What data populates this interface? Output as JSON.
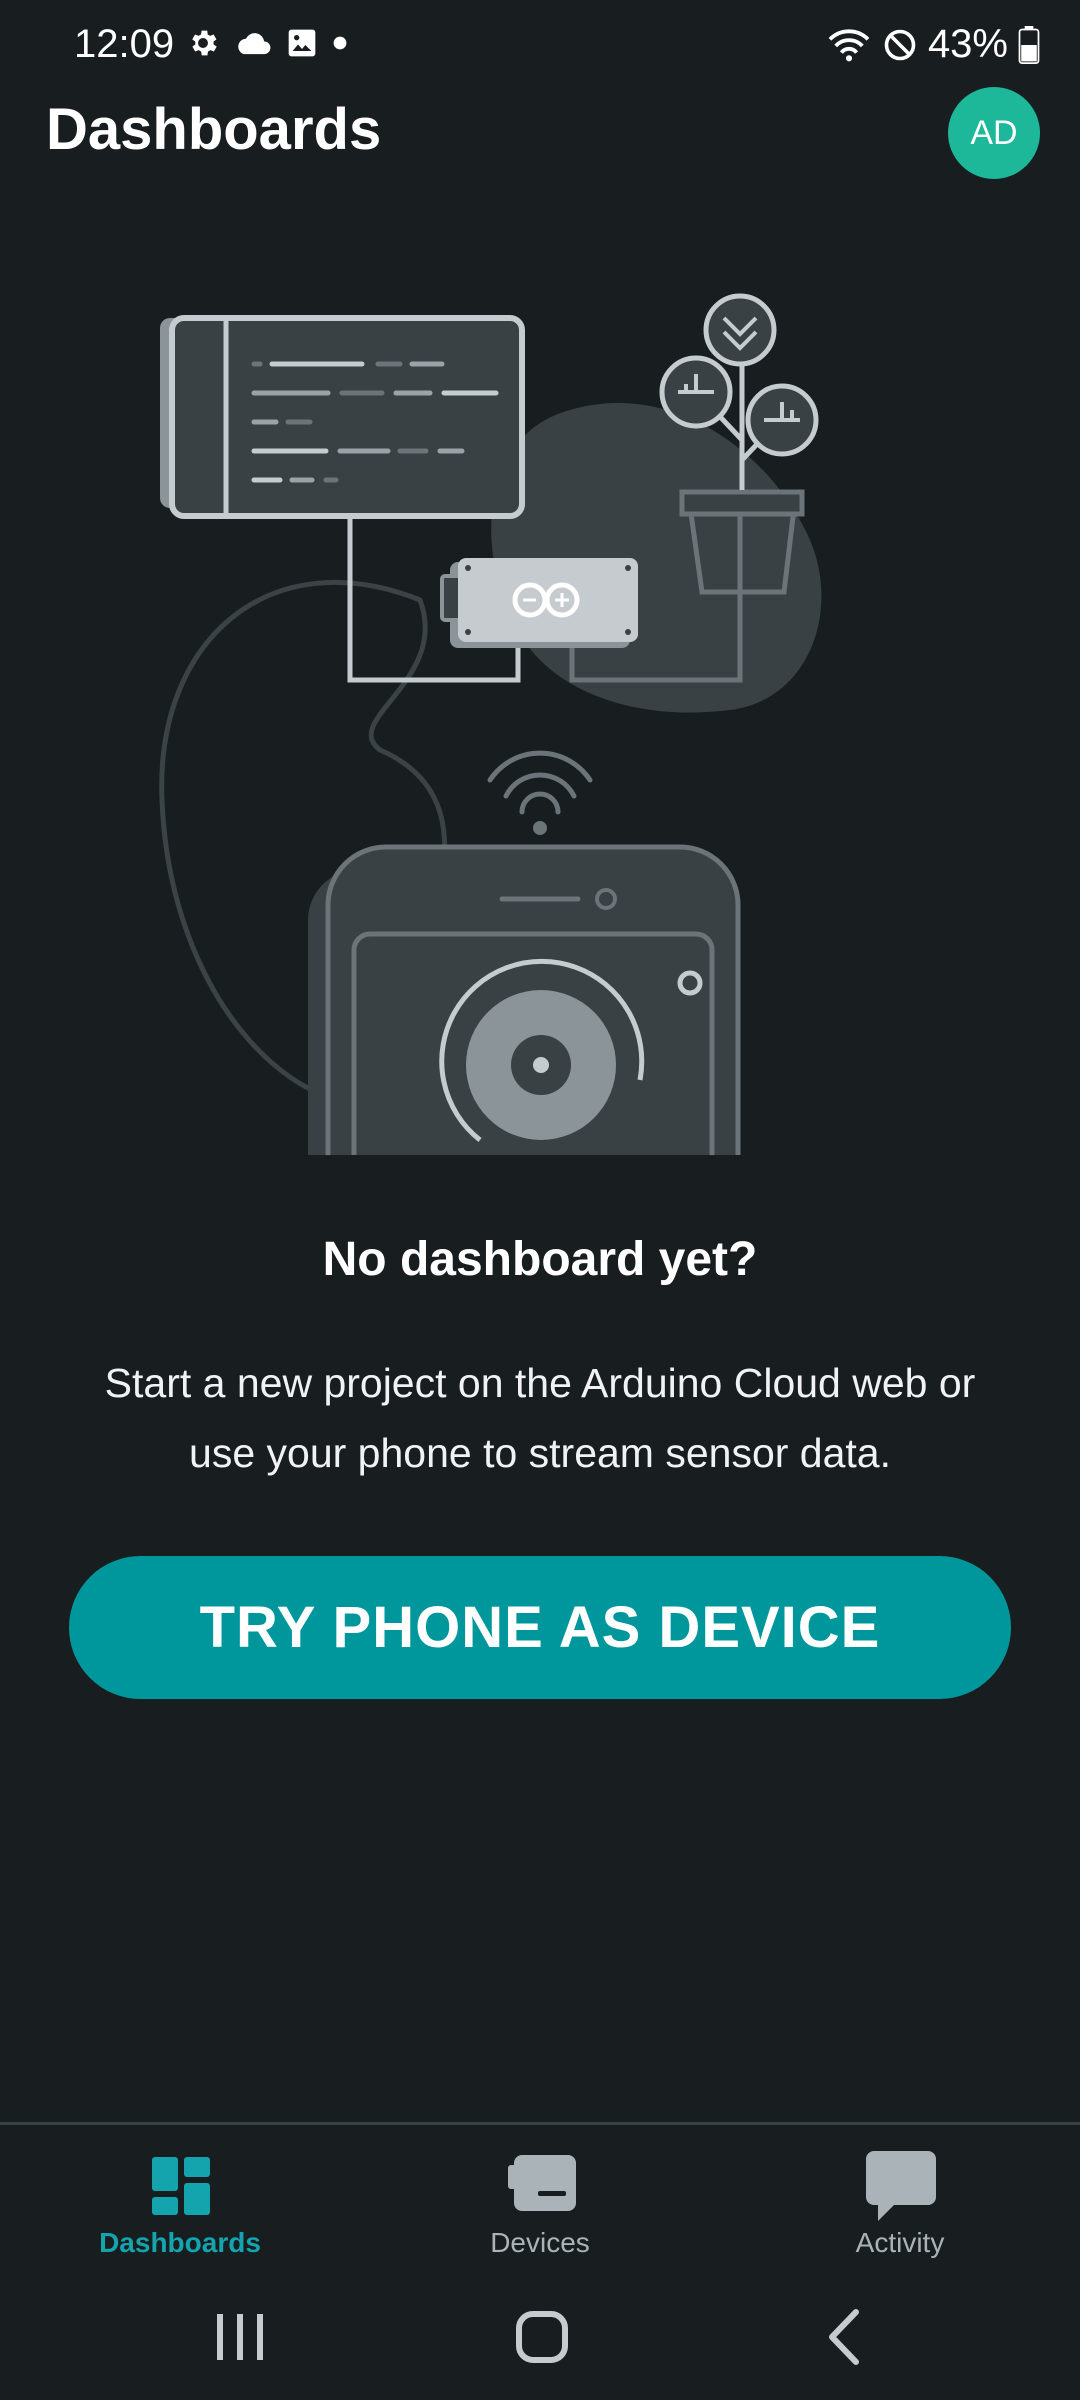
{
  "status_bar": {
    "time": "12:09",
    "battery": "43%"
  },
  "header": {
    "title": "Dashboards",
    "avatar_initials": "AD"
  },
  "empty_state": {
    "title": "No dashboard yet?",
    "description": "Start a new project on the Arduino Cloud web or use your phone to stream sensor data."
  },
  "cta": {
    "label": "TRY PHONE AS DEVICE"
  },
  "bottom_nav": {
    "items": [
      {
        "label": "Dashboards",
        "icon": "dashboard-icon",
        "active": true
      },
      {
        "label": "Devices",
        "icon": "device-icon",
        "active": false
      },
      {
        "label": "Activity",
        "icon": "chat-icon",
        "active": false
      }
    ]
  },
  "colors": {
    "background": "#181d20",
    "accent": "#00979c",
    "avatar": "#1db79a",
    "active_nav": "#13a4ad"
  }
}
